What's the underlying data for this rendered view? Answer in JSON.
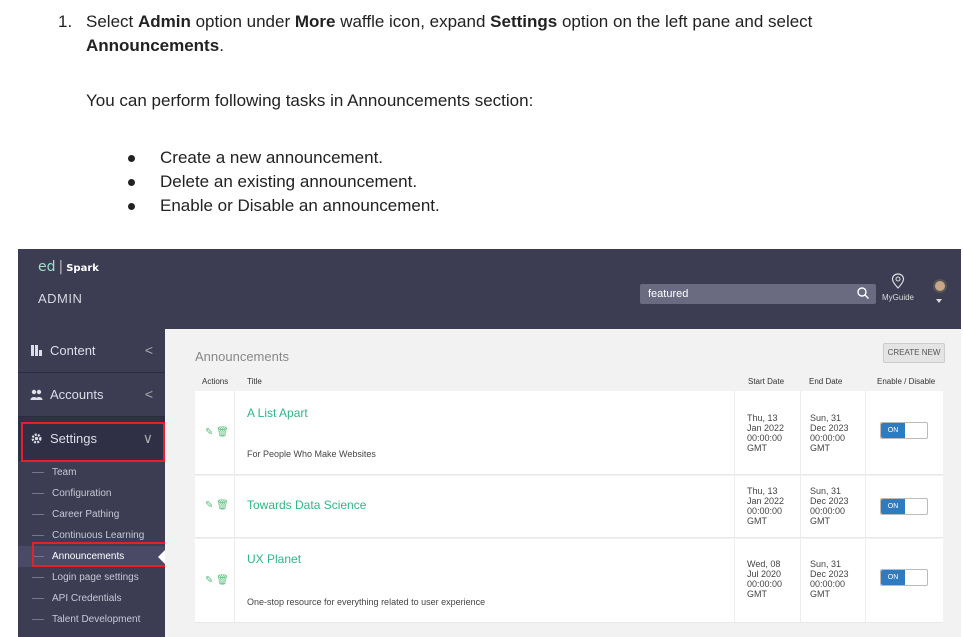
{
  "doc": {
    "step_number": "1.",
    "step_parts": [
      "Select ",
      "Admin",
      " option under ",
      "More",
      " waffle icon, expand ",
      "Settings",
      " option on the left pane and select ",
      "Announcements",
      "."
    ],
    "intro": "You can perform following tasks in Announcements section:",
    "bullets": [
      "Create a new announcement.",
      "Delete an existing announcement.",
      "Enable or Disable an announcement."
    ]
  },
  "app": {
    "logo_ed": "ed",
    "logo_sep": "|",
    "logo_spark": "Spark",
    "admin_label": "ADMIN",
    "search_value": "featured",
    "myguide_label": "MyGuide",
    "sidebar": {
      "items": [
        {
          "label": "Content",
          "chevron": "<"
        },
        {
          "label": "Accounts",
          "chevron": "<"
        },
        {
          "label": "Settings",
          "chevron": "∨"
        }
      ],
      "subitems": [
        "Team",
        "Configuration",
        "Career Pathing",
        "Continuous Learning",
        "Announcements",
        "Login page settings",
        "API Credentials",
        "Talent Development"
      ]
    },
    "main": {
      "title": "Announcements",
      "create_button": "CREATE NEW",
      "columns": [
        "Actions",
        "Title",
        "Start Date",
        "End Date",
        "Enable / Disable"
      ],
      "rows": [
        {
          "title": "A List Apart",
          "subtitle": "For People Who Make Websites",
          "start": [
            "Thu, 13",
            "Jan 2022",
            "00:00:00",
            "GMT"
          ],
          "end": [
            "Sun, 31",
            "Dec 2023",
            "00:00:00",
            "GMT"
          ],
          "toggle": "ON"
        },
        {
          "title": "Towards Data Science",
          "subtitle": "",
          "start": [
            "Thu, 13",
            "Jan 2022",
            "00:00:00",
            "GMT"
          ],
          "end": [
            "Sun, 31",
            "Dec 2023",
            "00:00:00",
            "GMT"
          ],
          "toggle": "ON"
        },
        {
          "title": "UX Planet",
          "subtitle": "One-stop resource for everything related to user experience",
          "start": [
            "Wed, 08",
            "Jul 2020",
            "00:00:00",
            "GMT"
          ],
          "end": [
            "Sun, 31",
            "Dec 2023",
            "00:00:00",
            "GMT"
          ],
          "toggle": "ON"
        }
      ]
    },
    "colors": {
      "sidebar": "#3c3c53",
      "accent_green": "#2fb58a",
      "toggle_blue": "#2f7bc0",
      "highlight_red": "#e5202a"
    }
  }
}
